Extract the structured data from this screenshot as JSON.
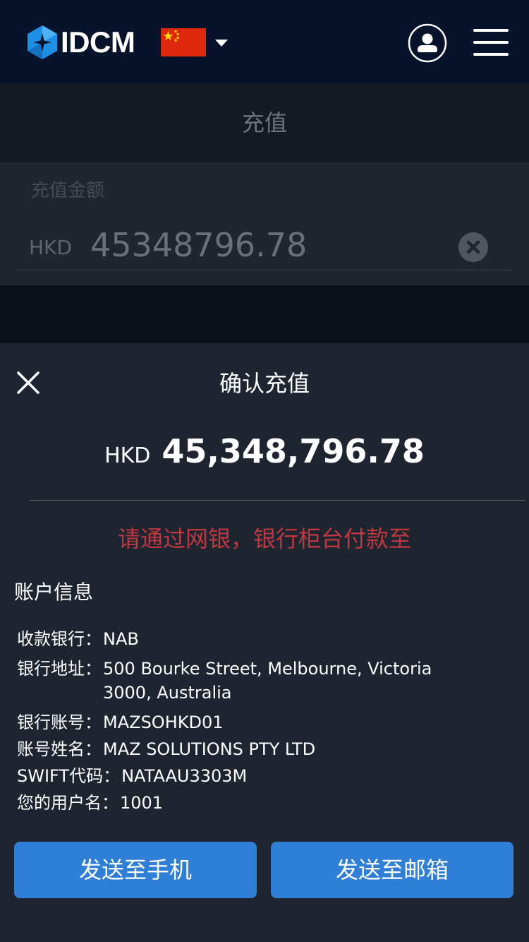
{
  "header": {
    "brand": "IDCM",
    "language_flag": "china-flag-icon",
    "colors": {
      "background": "#07132b",
      "logo": "#1f8fe5"
    }
  },
  "page": {
    "title": "充值",
    "amount_label": "充值金额",
    "currency": "HKD",
    "amount_input_value": "45348796.78"
  },
  "dialog": {
    "title": "确认充值",
    "currency": "HKD",
    "amount": "45,348,796.78",
    "notice": "请通过网银，银行柜台付款至",
    "section_title": "账户信息",
    "rows": [
      {
        "label": "收款银行：",
        "value": "NAB"
      },
      {
        "label": "银行地址：",
        "value": "500 Bourke Street, Melbourne, Victoria 3000, Australia"
      },
      {
        "label": "银行账号：",
        "value": "MAZSOHKD01"
      },
      {
        "label": "账号姓名：",
        "value": "MAZ SOLUTIONS PTY LTD"
      },
      {
        "label": "SWIFT代码：",
        "value": "NATAAU3303M"
      },
      {
        "label": "您的用户名：",
        "value": "1001"
      }
    ],
    "buttons": {
      "send_to_phone": "发送至手机",
      "send_to_email": "发送至邮箱"
    },
    "colors": {
      "notice": "#c0383f",
      "button": "#2e7fd5",
      "sheet": "#1e2531"
    }
  }
}
